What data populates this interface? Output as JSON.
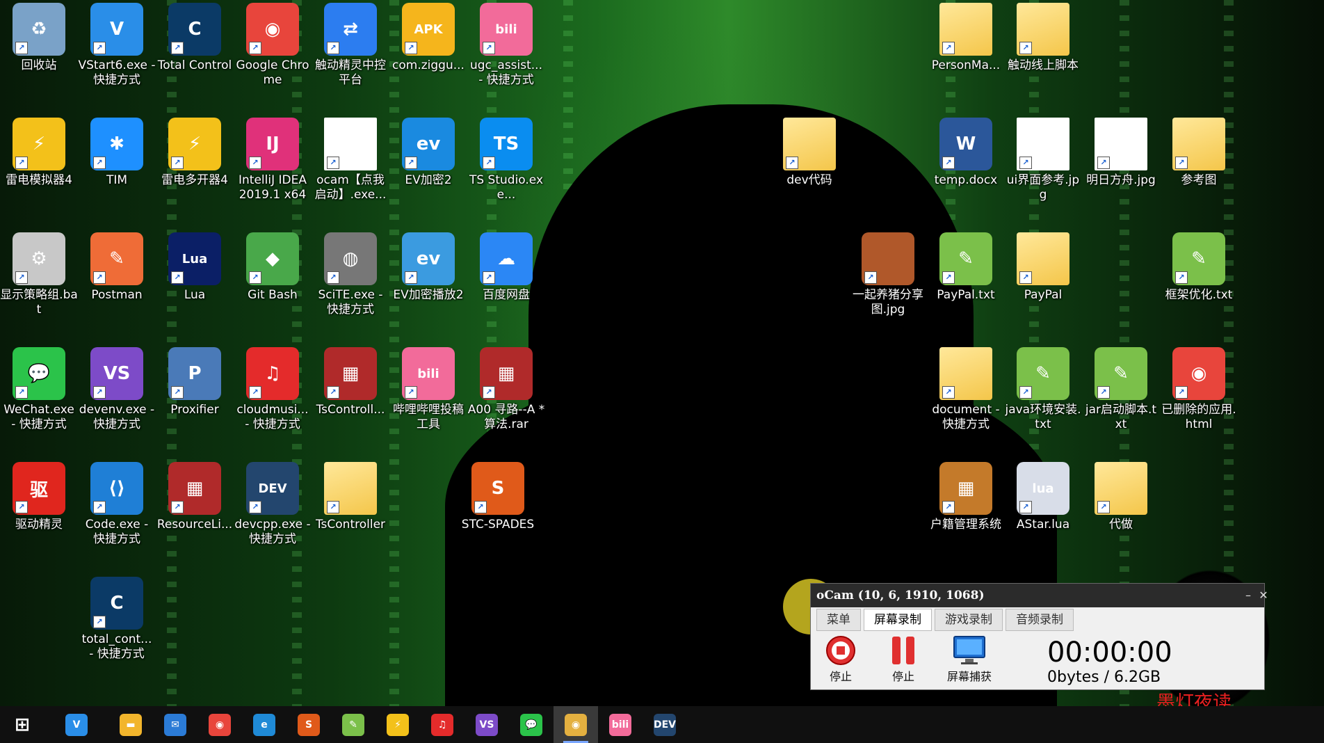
{
  "desktop": {
    "icons": [
      {
        "id": "recycle",
        "label": "回收站",
        "glyph": "♻",
        "color": "#7aa2c8",
        "type": "app"
      },
      {
        "id": "vstart",
        "label": "VStart6.exe - 快捷方式",
        "glyph": "V",
        "color": "#2a8ee8",
        "type": "app"
      },
      {
        "id": "tc",
        "label": "Total Control",
        "glyph": "C",
        "color": "#0b3a66",
        "type": "app"
      },
      {
        "id": "chrome",
        "label": "Google Chrome",
        "glyph": "◉",
        "color": "#e8453c",
        "type": "app"
      },
      {
        "id": "touch",
        "label": "触动精灵中控平台",
        "glyph": "⇄",
        "color": "#2c7df0",
        "type": "app"
      },
      {
        "id": "apk",
        "label": "com.ziggu...",
        "glyph": "APK",
        "color": "#f5b51c",
        "type": "app"
      },
      {
        "id": "ugc",
        "label": "ugc_assist... - 快捷方式",
        "glyph": "bili",
        "color": "#f26b9a",
        "type": "app"
      },
      {
        "id": "ld4",
        "label": "雷电模拟器4",
        "glyph": "⚡",
        "color": "#f3c11a",
        "type": "app"
      },
      {
        "id": "tim",
        "label": "TIM",
        "glyph": "✱",
        "color": "#1e90ff",
        "type": "app"
      },
      {
        "id": "ldm",
        "label": "雷电多开器4",
        "glyph": "⚡",
        "color": "#f3c11a",
        "type": "app"
      },
      {
        "id": "idea",
        "label": "IntelliJ IDEA 2019.1 x64",
        "glyph": "IJ",
        "color": "#e0317a",
        "type": "app"
      },
      {
        "id": "ocam",
        "label": "ocam【点我启动】.exe...",
        "glyph": "",
        "color": "#ffffff",
        "type": "doc"
      },
      {
        "id": "ev2",
        "label": "EV加密2",
        "glyph": "ev",
        "color": "#1a8ae0",
        "type": "app"
      },
      {
        "id": "ts",
        "label": "TS Studio.exe...",
        "glyph": "TS",
        "color": "#0a8df0",
        "type": "app"
      },
      {
        "id": "policy",
        "label": "显示策略组.bat",
        "glyph": "⚙",
        "color": "#c8c8c8",
        "type": "app"
      },
      {
        "id": "postman",
        "label": "Postman",
        "glyph": "✎",
        "color": "#ef6c37",
        "type": "app"
      },
      {
        "id": "lua",
        "label": "Lua",
        "glyph": "Lua",
        "color": "#0b1f66",
        "type": "app"
      },
      {
        "id": "gitbash",
        "label": "Git Bash",
        "glyph": "◆",
        "color": "#49a84a",
        "type": "app"
      },
      {
        "id": "scite",
        "label": "SciTE.exe - 快捷方式",
        "glyph": "◍",
        "color": "#777777",
        "type": "app"
      },
      {
        "id": "evplay",
        "label": "EV加密播放2",
        "glyph": "ev",
        "color": "#3b9be0",
        "type": "app"
      },
      {
        "id": "baidu",
        "label": "百度网盘",
        "glyph": "☁",
        "color": "#2b87f5",
        "type": "app"
      },
      {
        "id": "wechat",
        "label": "WeChat.exe - 快捷方式",
        "glyph": "💬",
        "color": "#2bc34a",
        "type": "app"
      },
      {
        "id": "devenv",
        "label": "devenv.exe - 快捷方式",
        "glyph": "VS",
        "color": "#7d4bc8",
        "type": "app"
      },
      {
        "id": "proxifier",
        "label": "Proxifier",
        "glyph": "P",
        "color": "#4a7ab8",
        "type": "app"
      },
      {
        "id": "cloud",
        "label": "cloudmusi... - 快捷方式",
        "glyph": "♫",
        "color": "#e42b2b",
        "type": "app"
      },
      {
        "id": "tsctl",
        "label": "TsControll...",
        "glyph": "▦",
        "color": "#b02a2a",
        "type": "app"
      },
      {
        "id": "bilitool",
        "label": "哔哩哔哩投稿工具",
        "glyph": "bili",
        "color": "#f26b9a",
        "type": "app"
      },
      {
        "id": "a00",
        "label": "A00 寻路--A * 算法.rar",
        "glyph": "▦",
        "color": "#b02a2a",
        "type": "app"
      },
      {
        "id": "driver",
        "label": "驱动精灵",
        "glyph": "驱",
        "color": "#e0261e",
        "type": "app"
      },
      {
        "id": "code",
        "label": "Code.exe - 快捷方式",
        "glyph": "⟨⟩",
        "color": "#1f7fd6",
        "type": "app"
      },
      {
        "id": "reslib",
        "label": "ResourceLi...",
        "glyph": "▦",
        "color": "#b02a2a",
        "type": "app"
      },
      {
        "id": "devcpp",
        "label": "devcpp.exe - 快捷方式",
        "glyph": "DEV",
        "color": "#23466e",
        "type": "app"
      },
      {
        "id": "tscontroller",
        "label": "TsController",
        "glyph": "",
        "color": "#f4c64a",
        "type": "folder"
      },
      {
        "id": "stc",
        "label": "STC-SPADES",
        "glyph": "S",
        "color": "#e05a1a",
        "type": "app"
      },
      {
        "id": "totalcont",
        "label": "total_cont... - 快捷方式",
        "glyph": "C",
        "color": "#0b3a66",
        "type": "app"
      },
      {
        "id": "person",
        "label": "PersonMa...",
        "glyph": "",
        "color": "#f4c64a",
        "type": "folder"
      },
      {
        "id": "touchline",
        "label": "触动线上脚本",
        "glyph": "",
        "color": "#f4c64a",
        "type": "folder"
      },
      {
        "id": "devcode",
        "label": "dev代码",
        "glyph": "",
        "color": "#f4c64a",
        "type": "folder"
      },
      {
        "id": "tempdocx",
        "label": "temp.docx",
        "glyph": "W",
        "color": "#2b579a",
        "type": "app"
      },
      {
        "id": "uiref",
        "label": "ui界面参考.jpg",
        "glyph": "",
        "color": "#ffffff",
        "type": "doc"
      },
      {
        "id": "mingri",
        "label": "明日方舟.jpg",
        "glyph": "",
        "color": "#ffffff",
        "type": "doc"
      },
      {
        "id": "cankao",
        "label": "参考图",
        "glyph": "",
        "color": "#f4c64a",
        "type": "folder"
      },
      {
        "id": "pig",
        "label": "一起养猪分享图.jpg",
        "glyph": "",
        "color": "#b0582a",
        "type": "app"
      },
      {
        "id": "paypaltxt",
        "label": "PayPal.txt",
        "glyph": "✎",
        "color": "#7bc04a",
        "type": "app"
      },
      {
        "id": "paypal",
        "label": "PayPal",
        "glyph": "",
        "color": "#f4c64a",
        "type": "folder"
      },
      {
        "id": "kuangjia",
        "label": "框架优化.txt",
        "glyph": "✎",
        "color": "#7bc04a",
        "type": "app"
      },
      {
        "id": "document",
        "label": "document - 快捷方式",
        "glyph": "",
        "color": "#f4c64a",
        "type": "folder"
      },
      {
        "id": "javaenv",
        "label": "java环境安装.txt",
        "glyph": "✎",
        "color": "#7bc04a",
        "type": "app"
      },
      {
        "id": "jarstart",
        "label": "jar启动脚本.txt",
        "glyph": "✎",
        "color": "#7bc04a",
        "type": "app"
      },
      {
        "id": "deleted",
        "label": "已删除的应用.html",
        "glyph": "◉",
        "color": "#e8453c",
        "type": "app"
      },
      {
        "id": "huji",
        "label": "户籍管理系统",
        "glyph": "▦",
        "color": "#c47a2a",
        "type": "app"
      },
      {
        "id": "astar",
        "label": "AStar.lua",
        "glyph": "lua",
        "color": "#d8dde8",
        "type": "app"
      },
      {
        "id": "daizuo",
        "label": "代做",
        "glyph": "",
        "color": "#f4c64a",
        "type": "folder"
      }
    ]
  },
  "ocam": {
    "title": "oCam (10, 6, 1910, 1068)",
    "tabs": [
      "菜单",
      "屏幕录制",
      "游戏录制",
      "音频录制"
    ],
    "active_tab": "屏幕录制",
    "tools": [
      {
        "label": "停止",
        "icon": "stop-record-icon"
      },
      {
        "label": "停止",
        "icon": "pause-icon"
      },
      {
        "label": "屏幕捕获",
        "icon": "monitor-icon"
      }
    ],
    "timer": "00:00:00",
    "bytes": "0bytes / 6.2GB",
    "minimize": "–",
    "close": "✕"
  },
  "watermark": "墨灯夜读",
  "taskbar": {
    "items": [
      {
        "id": "start",
        "glyph": "⊞",
        "color": "#101010"
      },
      {
        "id": "vsearch",
        "glyph": "V",
        "color": "#2a8ee8"
      },
      {
        "id": "explorer",
        "glyph": "▬",
        "color": "#f2b52c"
      },
      {
        "id": "mail",
        "glyph": "✉",
        "color": "#2b7bd6"
      },
      {
        "id": "chrome",
        "glyph": "◉",
        "color": "#e8453c"
      },
      {
        "id": "edge",
        "glyph": "e",
        "color": "#1f8ad6"
      },
      {
        "id": "stc",
        "glyph": "S",
        "color": "#e05a1a"
      },
      {
        "id": "notepad",
        "glyph": "✎",
        "color": "#7bc04a"
      },
      {
        "id": "ldm",
        "glyph": "⚡",
        "color": "#f3c11a"
      },
      {
        "id": "netease",
        "glyph": "♫",
        "color": "#e42b2b"
      },
      {
        "id": "vs",
        "glyph": "VS",
        "color": "#7d4bc8"
      },
      {
        "id": "wechat",
        "glyph": "💬",
        "color": "#2bc34a"
      },
      {
        "id": "ocam",
        "glyph": "◉",
        "color": "#e4b040"
      },
      {
        "id": "bili",
        "glyph": "bili",
        "color": "#f26b9a"
      },
      {
        "id": "devcpp",
        "glyph": "DEV",
        "color": "#23466e"
      }
    ],
    "active": "ocam"
  }
}
